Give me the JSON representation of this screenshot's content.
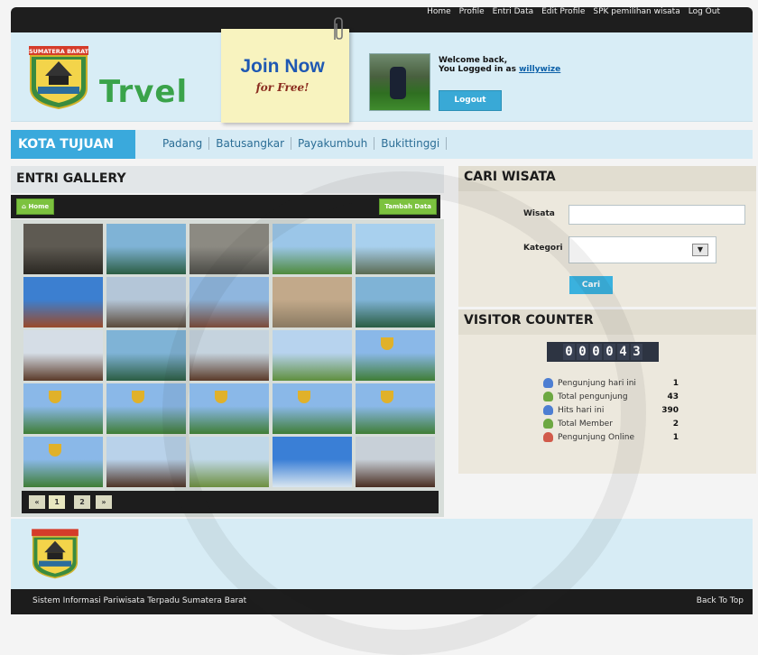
{
  "topnav": [
    "Home",
    "Profile",
    "Entri Data",
    "Edit Profile",
    "SPK pemilihan wisata",
    "Log Out"
  ],
  "logo": {
    "badge_text": "SUMATERA BARAT",
    "word": "Trvel"
  },
  "join": {
    "line1": "Join Now",
    "line2": "for Free!"
  },
  "user": {
    "welcome": "Welcome back,",
    "logged_prefix": "You Logged in as",
    "username": "willywize",
    "logout_label": "Logout"
  },
  "city_bar": {
    "title": "KOTA TUJUAN",
    "cities": [
      "Padang",
      "Batusangkar",
      "Payakumbuh",
      "Bukittinggi"
    ]
  },
  "gallery": {
    "title": "ENTRI GALLERY",
    "home_label": "Home",
    "add_label": "Tambah Data",
    "thumbs": [
      {
        "c1": "#5e5a52",
        "c2": "#2a2722",
        "shield": false
      },
      {
        "c1": "#7fb3d6",
        "c2": "#2b5d43",
        "shield": false
      },
      {
        "c1": "#8c8a82",
        "c2": "#4a4a45",
        "shield": false
      },
      {
        "c1": "#9bc6e8",
        "c2": "#4e8a3c",
        "shield": false
      },
      {
        "c1": "#a8d0ee",
        "c2": "#5a6b52",
        "shield": false
      },
      {
        "c1": "#3c7fd0",
        "c2": "#9a4a2a",
        "shield": false
      },
      {
        "c1": "#b4c6d8",
        "c2": "#5a4a3a",
        "shield": false
      },
      {
        "c1": "#8fb6de",
        "c2": "#7a4a38",
        "shield": false
      },
      {
        "c1": "#c2a98a",
        "c2": "#8a7a62",
        "shield": false
      },
      {
        "c1": "#7fb3d6",
        "c2": "#2b5d43",
        "shield": false
      },
      {
        "c1": "#d5dde6",
        "c2": "#5a3a28",
        "shield": false
      },
      {
        "c1": "#7fb3d6",
        "c2": "#2b5d43",
        "shield": false
      },
      {
        "c1": "#c5d3de",
        "c2": "#5a3a28",
        "shield": false
      },
      {
        "c1": "#b7d3ee",
        "c2": "#5f8f3e",
        "shield": false
      },
      {
        "c1": "#8ab8e8",
        "c2": "#3f7d36",
        "shield": true
      },
      {
        "c1": "#8ab8e8",
        "c2": "#3f7d36",
        "shield": true
      },
      {
        "c1": "#8ab8e8",
        "c2": "#3f7d36",
        "shield": true
      },
      {
        "c1": "#8ab8e8",
        "c2": "#3f7d36",
        "shield": true
      },
      {
        "c1": "#8ab8e8",
        "c2": "#3f7d36",
        "shield": true
      },
      {
        "c1": "#8ab8e8",
        "c2": "#3f7d36",
        "shield": true
      },
      {
        "c1": "#8ab8e8",
        "c2": "#3f7d36",
        "shield": true
      },
      {
        "c1": "#b9d2ea",
        "c2": "#4f3426",
        "shield": false
      },
      {
        "c1": "#c0d8e8",
        "c2": "#6d8f3f",
        "shield": false
      },
      {
        "c1": "#3a7fd6",
        "c2": "#d9e6f0",
        "shield": false
      },
      {
        "c1": "#c8d0d8",
        "c2": "#4a2e22",
        "shield": false
      }
    ],
    "pager": [
      "«",
      "1",
      "2",
      "»"
    ]
  },
  "search": {
    "title": "CARI WISATA",
    "wisata_label": "Wisata",
    "kategori_label": "Kategori",
    "button": "Cari"
  },
  "visitor": {
    "title": "VISITOR COUNTER",
    "digits": [
      "0",
      "0",
      "0",
      "0",
      "4",
      "3"
    ],
    "stats": [
      {
        "label": "Pengunjung hari ini",
        "value": "1",
        "color": "#4d7ed2"
      },
      {
        "label": "Total pengunjung",
        "value": "43",
        "color": "#6da842"
      },
      {
        "label": "Hits hari ini",
        "value": "390",
        "color": "#4d7ed2"
      },
      {
        "label": "Total Member",
        "value": "2",
        "color": "#6da842"
      },
      {
        "label": "Pengunjung Online",
        "value": "1",
        "color": "#d15a4a"
      }
    ]
  },
  "footer": {
    "left": "Sistem Informasi Pariwisata Terpadu Sumatera Barat",
    "right": "Back To Top"
  }
}
